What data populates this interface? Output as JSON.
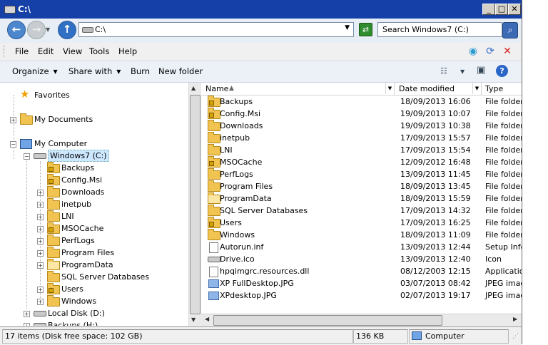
{
  "window": {
    "title": "C:\\"
  },
  "address": {
    "path": "C:\\",
    "search_placeholder": "Search Windows7 (C:)"
  },
  "menubar": {
    "items": [
      "File",
      "Edit",
      "View",
      "Tools",
      "Help"
    ]
  },
  "commandbar": {
    "organize": "Organize",
    "share": "Share with",
    "burn": "Burn",
    "newfolder": "New folder"
  },
  "tree": {
    "favorites": "Favorites",
    "mydocs": "My Documents",
    "mycomputer": "My Computer",
    "drive_c": "Windows7 (C:)",
    "folders": [
      "Backups",
      "Config.Msi",
      "Downloads",
      "inetpub",
      "LNI",
      "MSOCache",
      "PerfLogs",
      "Program Files",
      "ProgramData",
      "SQL Server Databases",
      "Users",
      "Windows"
    ],
    "drive_d": "Local Disk (D:)",
    "drive_h": "Backups (H:)"
  },
  "columns": {
    "name": "Name",
    "date": "Date modified",
    "type": "Type"
  },
  "files": [
    {
      "name": "Backups",
      "date": "18/09/2013 16:06",
      "type": "File folder",
      "icon": "folder-locked"
    },
    {
      "name": "Config.Msi",
      "date": "19/09/2013 10:07",
      "type": "File folder",
      "icon": "folder-locked"
    },
    {
      "name": "Downloads",
      "date": "19/09/2013 10:38",
      "type": "File folder",
      "icon": "folder"
    },
    {
      "name": "inetpub",
      "date": "17/09/2013 15:57",
      "type": "File folder",
      "icon": "folder"
    },
    {
      "name": "LNI",
      "date": "17/09/2013 15:54",
      "type": "File folder",
      "icon": "folder"
    },
    {
      "name": "MSOCache",
      "date": "12/09/2012 16:48",
      "type": "File folder",
      "icon": "folder-locked"
    },
    {
      "name": "PerfLogs",
      "date": "13/09/2013 11:45",
      "type": "File folder",
      "icon": "folder"
    },
    {
      "name": "Program Files",
      "date": "18/09/2013 13:45",
      "type": "File folder",
      "icon": "folder"
    },
    {
      "name": "ProgramData",
      "date": "18/09/2013 15:59",
      "type": "File folder",
      "icon": "folder-light"
    },
    {
      "name": "SQL Server Databases",
      "date": "17/09/2013 14:32",
      "type": "File folder",
      "icon": "folder"
    },
    {
      "name": "Users",
      "date": "17/09/2013 16:25",
      "type": "File folder",
      "icon": "folder-locked"
    },
    {
      "name": "Windows",
      "date": "18/09/2013 11:09",
      "type": "File folder",
      "icon": "folder"
    },
    {
      "name": "Autorun.inf",
      "date": "13/09/2013 12:44",
      "type": "Setup Infor",
      "icon": "file-inf"
    },
    {
      "name": "Drive.ico",
      "date": "13/09/2013 12:40",
      "type": "Icon",
      "icon": "drive-ico"
    },
    {
      "name": "hpqimgrc.resources.dll",
      "date": "08/12/2003 12:15",
      "type": "Application",
      "icon": "file-dll"
    },
    {
      "name": "XP FullDesktop.JPG",
      "date": "03/07/2013 08:42",
      "type": "JPEG imag",
      "icon": "image"
    },
    {
      "name": "XPdesktop.JPG",
      "date": "02/07/2013 19:17",
      "type": "JPEG imag",
      "icon": "image"
    }
  ],
  "status": {
    "items": "17 items (Disk free space: 102 GB)",
    "size": "136 KB",
    "zone": "Computer"
  }
}
